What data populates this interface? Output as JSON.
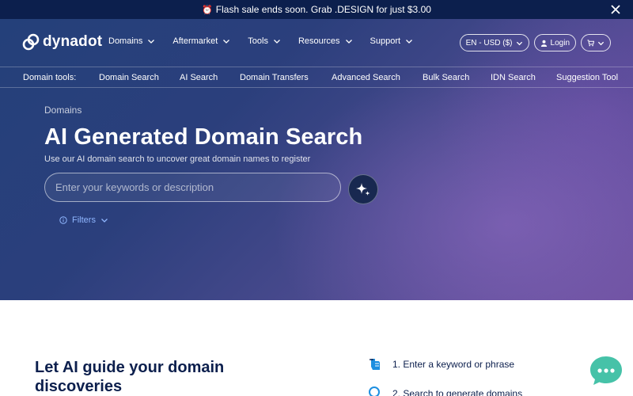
{
  "promo": {
    "text": "Flash sale ends soon. Grab .DESIGN for just $3.00"
  },
  "header": {
    "logo": "dynadot",
    "menu": [
      {
        "label": "Domains"
      },
      {
        "label": "Aftermarket"
      },
      {
        "label": "Tools"
      },
      {
        "label": "Resources"
      },
      {
        "label": "Support"
      }
    ],
    "locale": "EN - USD ($)",
    "login": "Login"
  },
  "domain_tools": {
    "label": "Domain tools:",
    "items": [
      "Domain Search",
      "AI Search",
      "Domain Transfers",
      "Advanced Search",
      "Bulk Search",
      "IDN Search",
      "Suggestion Tool"
    ]
  },
  "hero": {
    "breadcrumb": "Domains",
    "title": "AI Generated Domain Search",
    "subtitle": "Use our AI domain search to uncover great domain names to register",
    "search_placeholder": "Enter your keywords or description",
    "filters": "Filters"
  },
  "guide": {
    "title_line1": "Let AI guide your domain",
    "title_line2": "discoveries",
    "steps": [
      "1. Enter a keyword or phrase",
      "2. Search to generate domains"
    ]
  },
  "colors": {
    "navy": "#0c1f4d",
    "accent": "#4b8bff",
    "chat": "#46c2a8"
  }
}
